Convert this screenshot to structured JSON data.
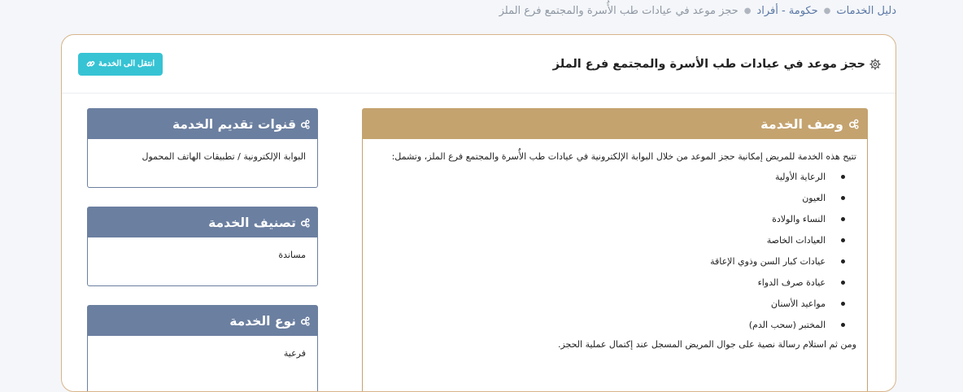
{
  "breadcrumb": {
    "items": [
      "دليل الخدمات",
      "حكومة - أفراد"
    ],
    "current": "حجز موعد في عيادات طب الأُسرة والمجتمع فرع الملز"
  },
  "header": {
    "title": "حجز موعد في عيادات طب الأسرة والمجتمع فرع الملز",
    "go_button": "انتقل الى الخدمة"
  },
  "description": {
    "heading": "وصف الخدمة",
    "intro": "تتيح هذه الخدمة للمريض إمكانية حجز الموعد من خلال البوابة الإلكترونية في عيادات طب الأُسرة والمجتمع فرع الملز، وتشمل:",
    "items": [
      "الرعاية الأولية",
      "العيون",
      "النساء والولادة",
      "العيادات الخاصة",
      "عيادات كبار السن وذوي الإعاقة",
      "عيادة صرف الدواء",
      "مواعيد الأسنان",
      "المختبر (سحب الدم)"
    ],
    "outro": "ومن ثم استلام رسالة نصية على جوال المريض المسجل عند إكتمال عملية الحجز."
  },
  "channels": {
    "heading": "قنوات تقديم الخدمة",
    "value": "البوابة الإلكترونية / تطبيقات الهاتف المحمول"
  },
  "classification": {
    "heading": "تصنيف الخدمة",
    "value": "مساندة"
  },
  "type": {
    "heading": "نوع الخدمة",
    "value": "فرعية"
  },
  "colors": {
    "accent_teal": "#36c3d4",
    "gold": "#c4a36f",
    "slate": "#6b7fa0",
    "link": "#5b78a6"
  }
}
